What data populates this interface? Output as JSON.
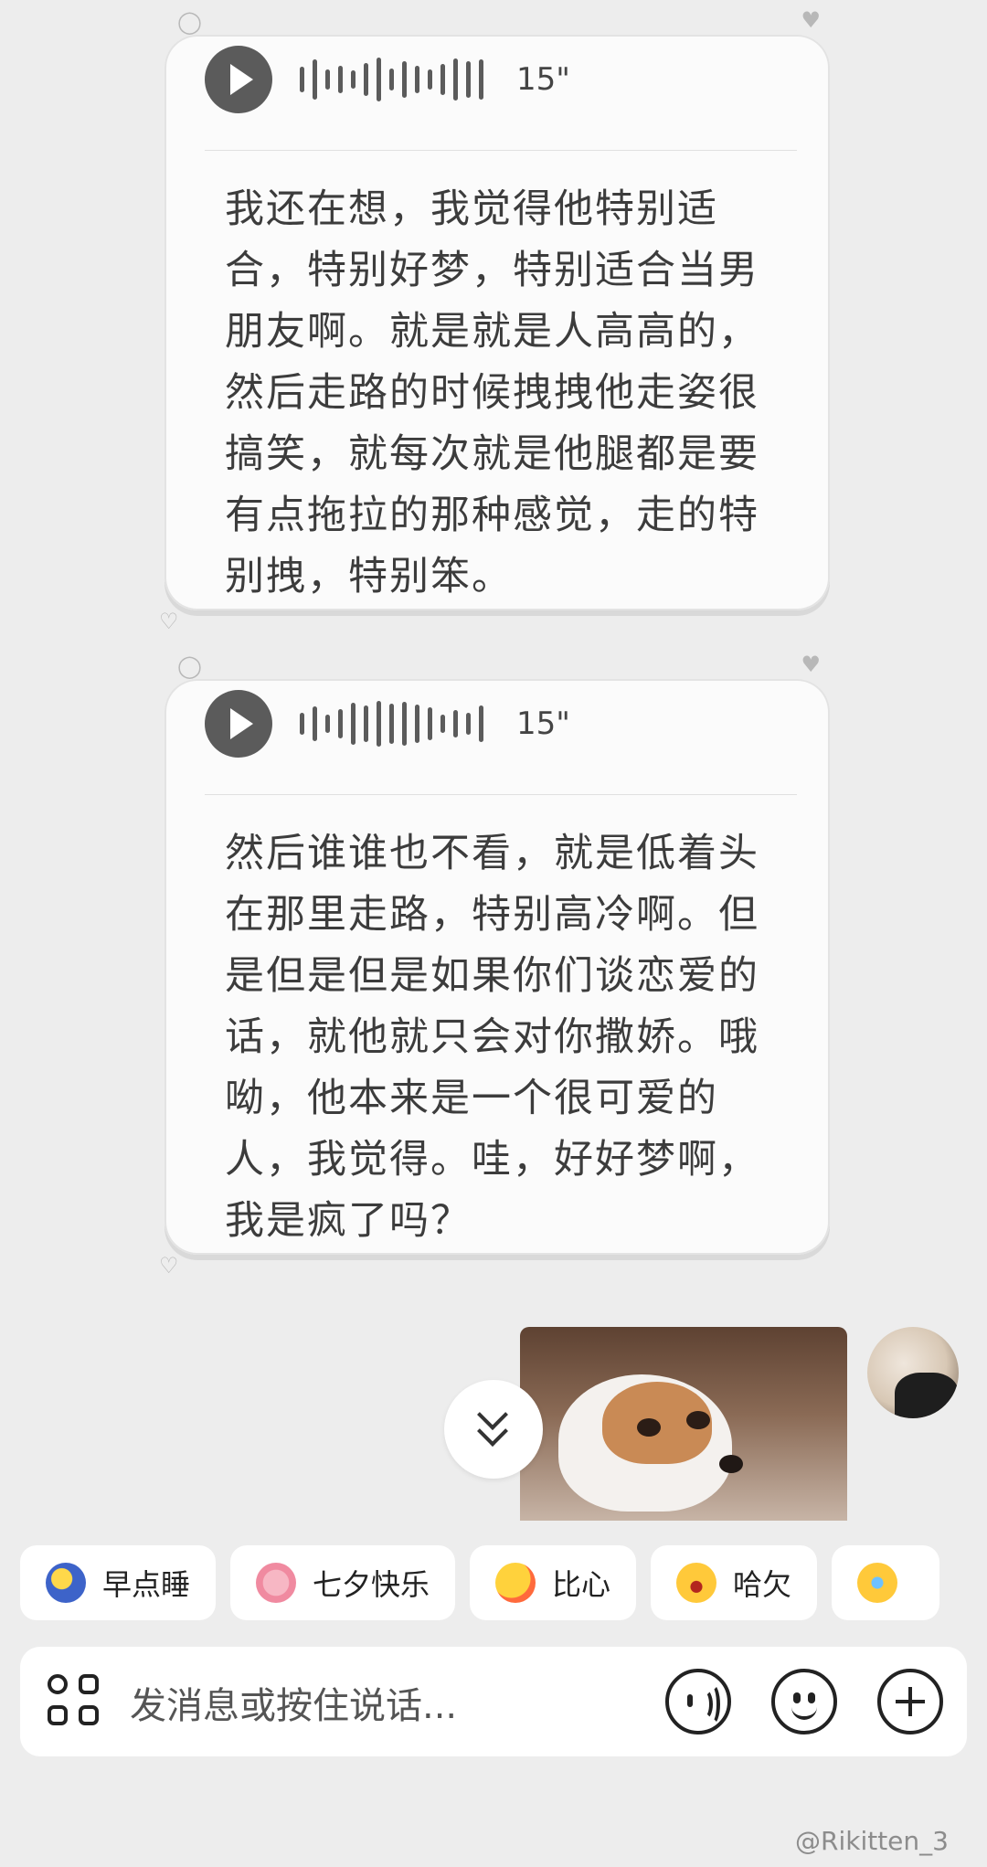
{
  "messages": [
    {
      "duration": "15\"",
      "transcript": "我还在想，我觉得他特别适合，特别好梦，特别适合当男朋友啊。就是就是人高高的，然后走路的时候拽拽他走姿很搞笑，就每次就是他腿都是要有点拖拉的那种感觉，走的特别拽，特别笨。"
    },
    {
      "duration": "15\"",
      "transcript": "然后谁谁也不看，就是低着头在那里走路，特别高冷啊。但是但是但是如果你们谈恋爱的话，就他就只会对你撒娇。哦呦，他本来是一个很可爱的人，我觉得。哇，好好梦啊，我是疯了吗？"
    }
  ],
  "quick_replies": [
    {
      "label": "早点睡",
      "icon": "sleepy-moon-icon"
    },
    {
      "label": "七夕快乐",
      "icon": "bird-icon"
    },
    {
      "label": "比心",
      "icon": "finger-heart-icon"
    },
    {
      "label": "哈欠",
      "icon": "yawn-face-icon"
    },
    {
      "label": "",
      "icon": "crying-face-icon"
    }
  ],
  "input": {
    "placeholder": "发消息或按住说话..."
  },
  "watermark": "@Rikitten_3",
  "colors": {
    "background": "#ededed",
    "bubble": "#fbfbfb",
    "play_button": "#5b5b5b",
    "text": "#3c3c3c"
  }
}
